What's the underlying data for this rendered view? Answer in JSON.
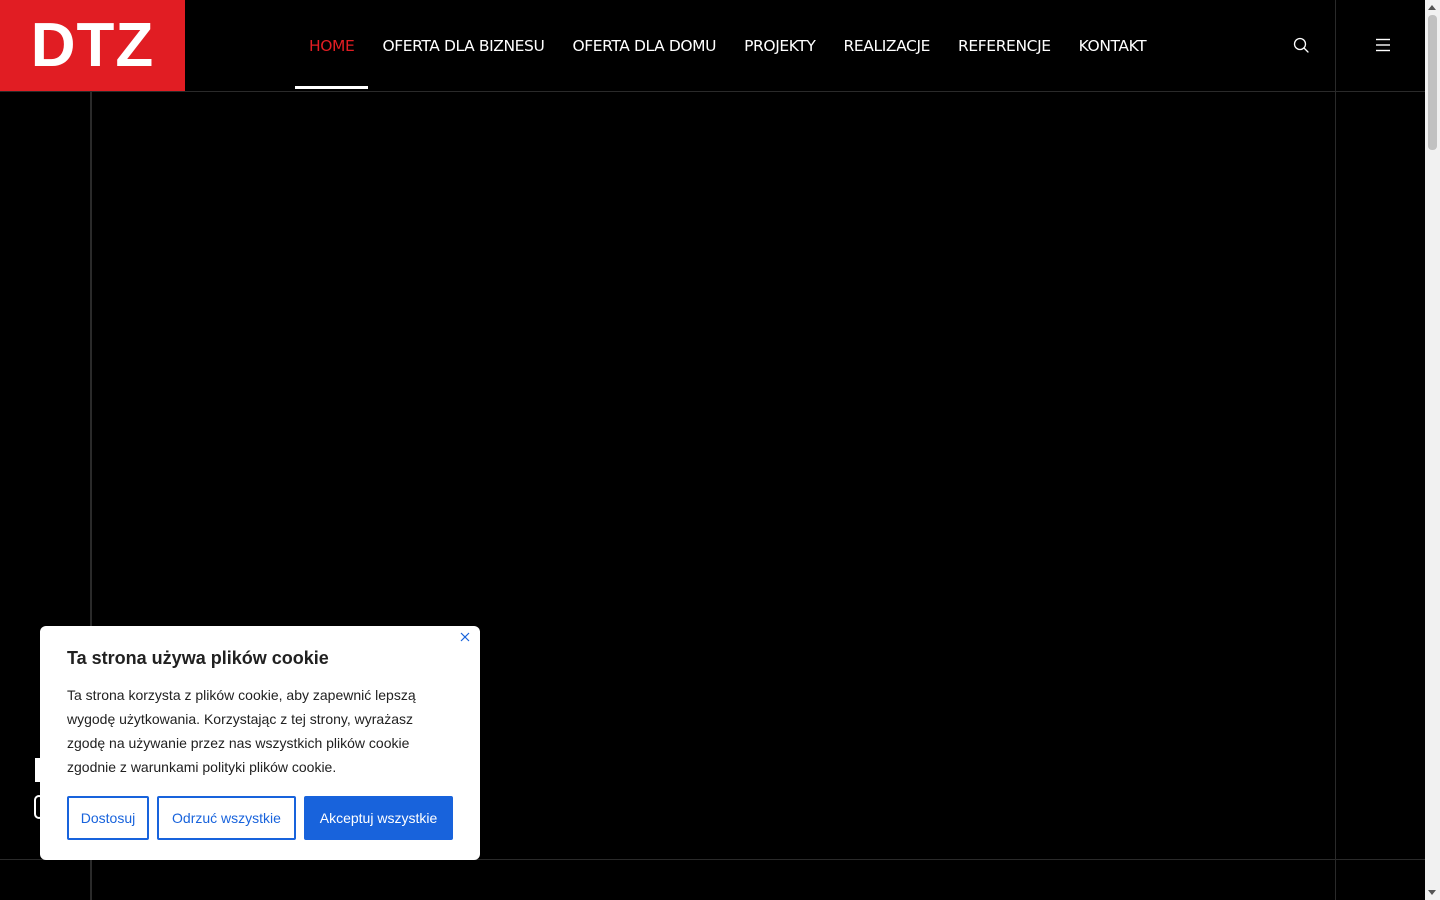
{
  "logo": {
    "text": "DTZ"
  },
  "nav": {
    "items": [
      {
        "label": "HOME",
        "active": true
      },
      {
        "label": "OFERTA DLA BIZNESU"
      },
      {
        "label": "OFERTA DLA DOMU"
      },
      {
        "label": "PROJEKTY"
      },
      {
        "label": "REALIZACJE"
      },
      {
        "label": "REFERENCJE"
      },
      {
        "label": "KONTAKT"
      }
    ],
    "search_icon": "search-icon",
    "menu_icon": "hamburger-icon"
  },
  "colors": {
    "brand_red": "#e11d23",
    "background": "#000000",
    "cookie_accent": "#1863dc"
  },
  "cookie": {
    "title": "Ta strona używa plików cookie",
    "text": "Ta strona korzysta z plików cookie, aby zapewnić lepszą wygodę użytkowania. Korzystając z tej strony, wyrażasz zgodę na używanie przez nas wszystkich plików cookie zgodnie z warunkami polityki plików cookie.",
    "close_icon": "close-icon",
    "buttons": {
      "customize": "Dostosuj",
      "reject": "Odrzuć wszystkie",
      "accept": "Akceptuj wszystkie"
    }
  }
}
